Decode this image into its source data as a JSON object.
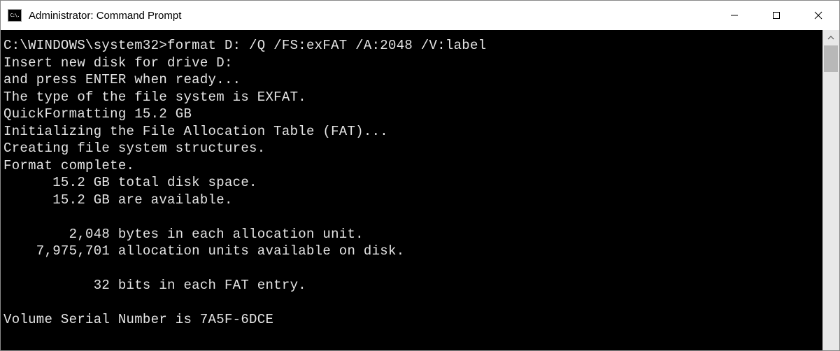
{
  "window": {
    "title": "Administrator: Command Prompt",
    "icon_label": "C:\\."
  },
  "terminal": {
    "prompt": "C:\\WINDOWS\\system32>",
    "command": "format D: /Q /FS:exFAT /A:2048 /V:label",
    "lines": [
      "Insert new disk for drive D:",
      "and press ENTER when ready...",
      "The type of the file system is EXFAT.",
      "QuickFormatting 15.2 GB",
      "Initializing the File Allocation Table (FAT)...",
      "Creating file system structures.",
      "Format complete.",
      "      15.2 GB total disk space.",
      "      15.2 GB are available.",
      "",
      "        2,048 bytes in each allocation unit.",
      "    7,975,701 allocation units available on disk.",
      "",
      "           32 bits in each FAT entry.",
      "",
      "Volume Serial Number is 7A5F-6DCE"
    ]
  }
}
